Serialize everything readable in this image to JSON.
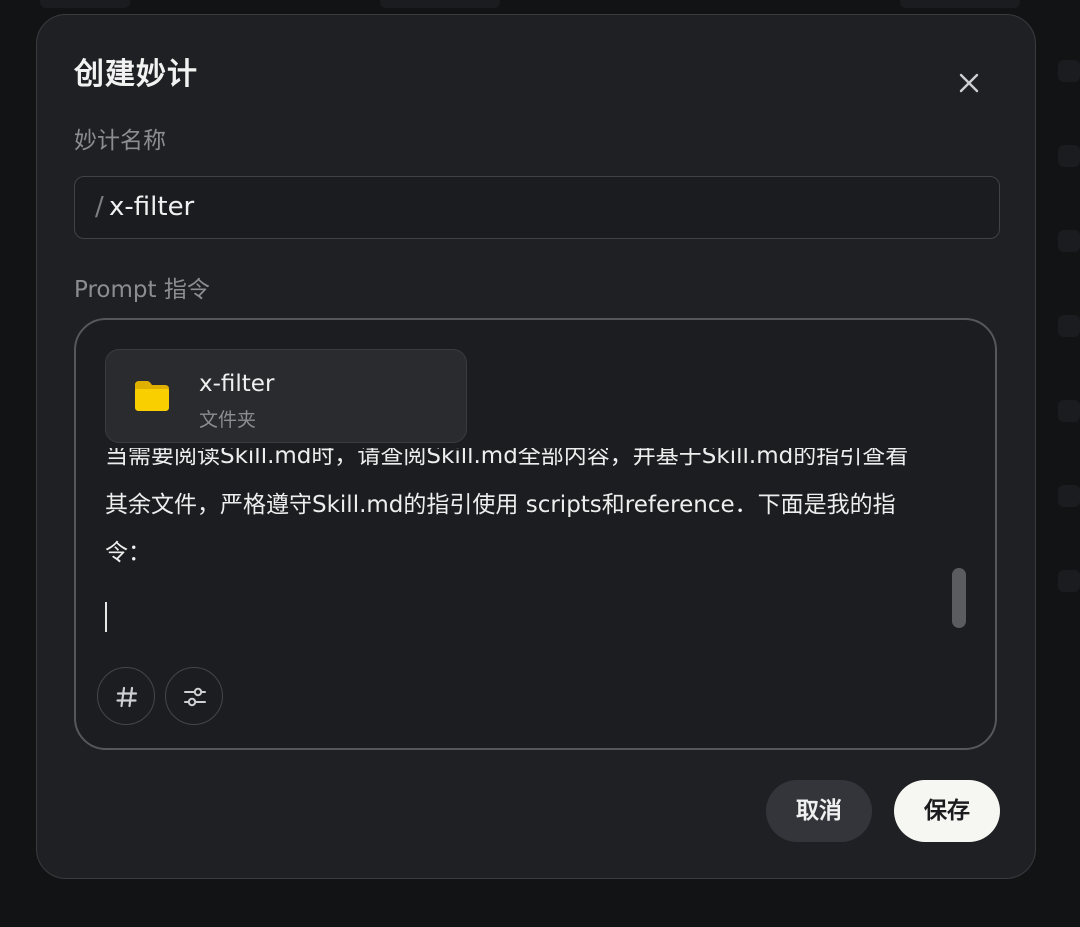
{
  "dialog": {
    "title": "创建妙计",
    "name_label": "妙计名称",
    "name_prefix": "/",
    "name_value": "x-filter",
    "prompt_label": "Prompt 指令"
  },
  "attachment": {
    "name": "x-filter",
    "type": "文件夹",
    "icon": "folder-icon",
    "icon_color": "#f5c400"
  },
  "prompt_text": {
    "line1": "当需要阅读Skill.md时，请查阅Skill.md全部内容，并基于Skill.md的指引查看",
    "line2": "其余文件，严格遵守Skill.md的指引使用  scripts和reference．下面是我的指",
    "line3": "令："
  },
  "toolbar": {
    "hash_icon": "hash-icon",
    "settings_icon": "sliders-icon"
  },
  "actions": {
    "cancel": "取消",
    "save": "保存"
  }
}
